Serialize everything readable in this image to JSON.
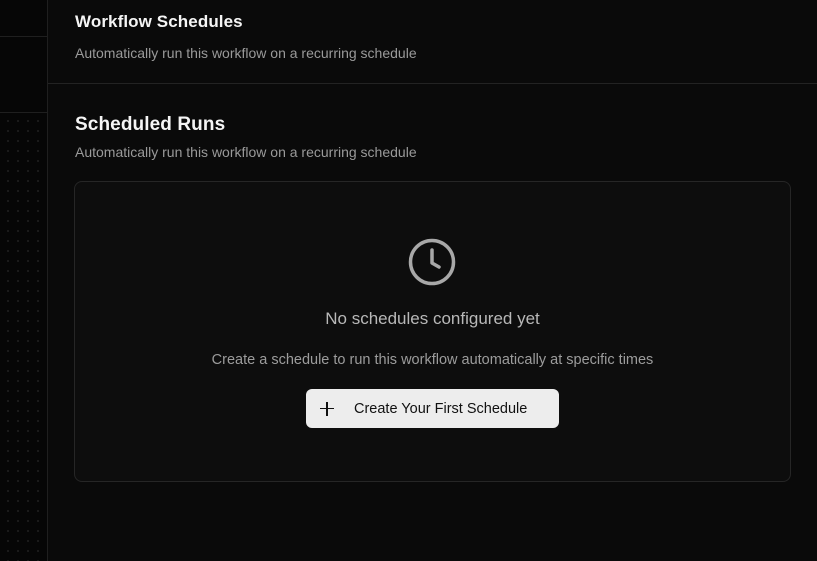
{
  "workflow_schedules": {
    "title": "Workflow Schedules",
    "description": "Automatically run this workflow on a recurring schedule"
  },
  "scheduled_runs": {
    "title": "Scheduled Runs",
    "description": "Automatically run this workflow on a recurring schedule",
    "empty_state": {
      "icon": "clock-icon",
      "title": "No schedules configured yet",
      "description": "Create a schedule to run this workflow automatically at specific times",
      "button_label": "Create Your First Schedule",
      "button_icon": "plus-icon"
    }
  },
  "colors": {
    "background": "#0a0a0a",
    "button_bg": "#ededed",
    "muted_text": "#9a9a9a",
    "border": "#262626"
  }
}
